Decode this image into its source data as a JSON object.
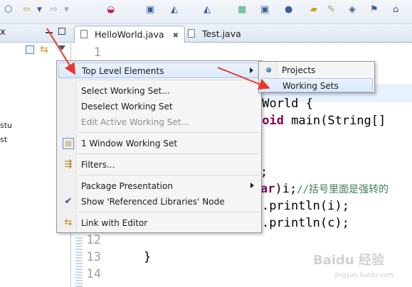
{
  "left_panel": {
    "tab_close": "x",
    "tree_items": [
      "stu",
      "st"
    ]
  },
  "editor": {
    "tabs": [
      {
        "label": "HelloWorld.java",
        "close": "✖"
      },
      {
        "label": "Test.java"
      }
    ],
    "line_numbers": [
      "1",
      "12",
      "13",
      "14"
    ],
    "code_lines": [
      {
        "text": "oWorld {"
      },
      {
        "kw": "void",
        "text": " main(String[]"
      },
      {
        "text": ";"
      },
      {
        "kw": "ar",
        "text": ")i;",
        "comment": "//括号里面是强转的"
      },
      {
        "text": ".println(i);"
      },
      {
        "text": ".println(c);"
      },
      {
        "text": "}"
      }
    ]
  },
  "context_menu": {
    "items": [
      {
        "label": "Top Level Elements",
        "submenu": true,
        "hover": true
      },
      {
        "label": "Select Working Set..."
      },
      {
        "label": "Deselect Working Set"
      },
      {
        "label": "Edit Active Working Set...",
        "disabled": true
      },
      {
        "label": "1 Window Working Set",
        "icon": "working-set-icon"
      },
      {
        "label": "Filters...",
        "icon": "filter-icon"
      },
      {
        "label": "Package Presentation",
        "submenu": true
      },
      {
        "label": "Show 'Referenced Libraries' Node",
        "checked": true,
        "icon": "checkmark-icon"
      },
      {
        "label": "Link with Editor",
        "icon": "link-icon"
      }
    ]
  },
  "submenu": {
    "items": [
      {
        "label": "Projects",
        "selected": true
      },
      {
        "label": "Working Sets",
        "hover": true
      }
    ]
  },
  "colors": {
    "annotation_arrow": "#e8382c",
    "menu_hover": "#dbe9fb",
    "keyword": "#7f0055",
    "comment": "#3f7f5f"
  },
  "watermark": {
    "logo": "Baidu 经验",
    "url": "jingyan.baidu.com"
  }
}
